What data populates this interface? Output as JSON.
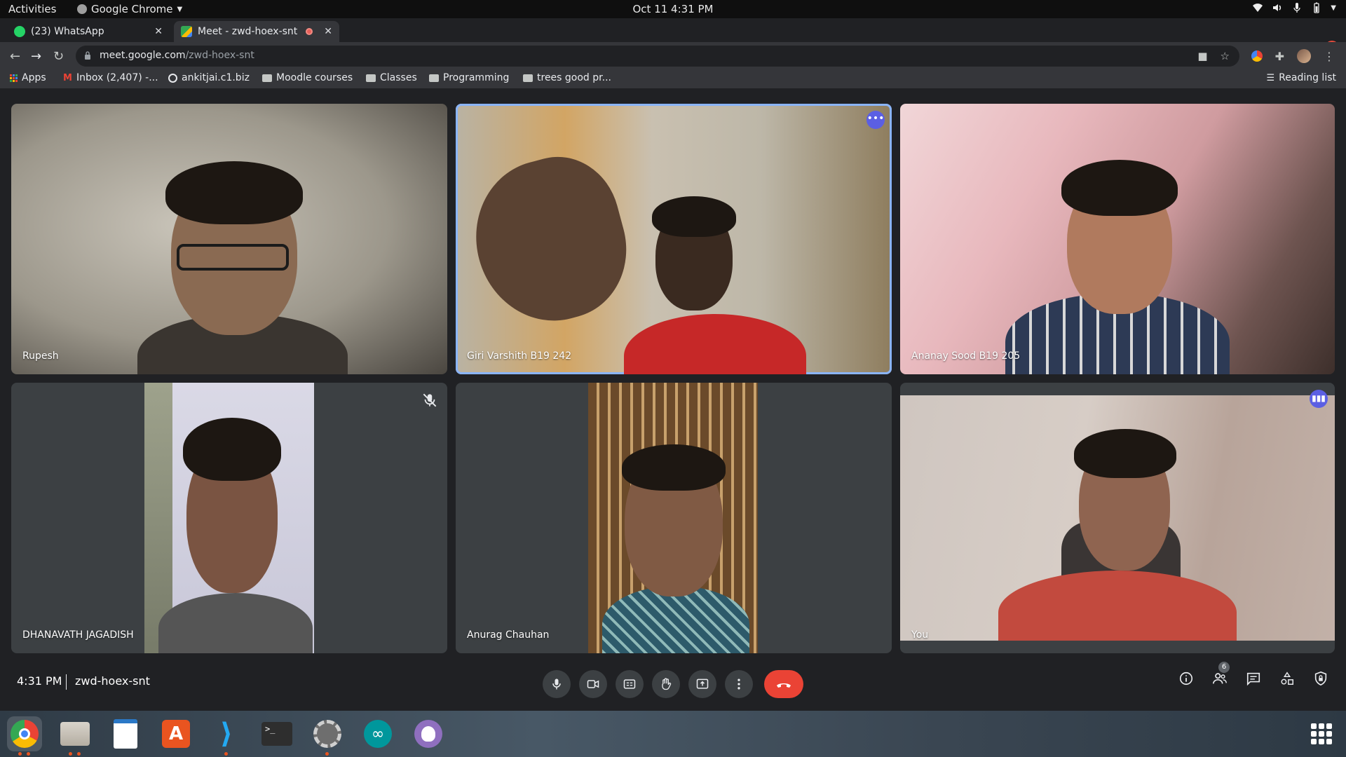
{
  "system_bar": {
    "activities": "Activities",
    "app_name": "Google Chrome",
    "datetime": "Oct 11  4:31 PM"
  },
  "browser": {
    "tabs": [
      {
        "title": "(23) WhatsApp",
        "icon": "whatsapp-icon",
        "active": false
      },
      {
        "title": "Meet - zwd-hoex-snt",
        "icon": "meet-icon",
        "active": true,
        "recording": true
      }
    ],
    "url_domain": "meet.google.com",
    "url_path": "/zwd-hoex-snt",
    "bookmarks": [
      {
        "label": "Apps",
        "icon": "apps-grid-icon"
      },
      {
        "label": "Inbox (2,407) -...",
        "icon": "gmail-icon"
      },
      {
        "label": "ankitjai.c1.biz",
        "icon": "globe-icon"
      },
      {
        "label": "Moodle courses",
        "icon": "folder-icon"
      },
      {
        "label": "Classes",
        "icon": "folder-icon"
      },
      {
        "label": "Programming",
        "icon": "folder-icon"
      },
      {
        "label": "trees good pr...",
        "icon": "folder-icon"
      }
    ],
    "reading_list": "Reading list"
  },
  "meet": {
    "participants": [
      {
        "name": "Rupesh"
      },
      {
        "name": "Giri Varshith B19 242",
        "speaking": true
      },
      {
        "name": "Ananay Sood B19 205"
      },
      {
        "name": "DHANAVATH JAGADISH",
        "muted": true
      },
      {
        "name": "Anurag Chauhan"
      },
      {
        "name": "You"
      }
    ],
    "time": "4:31 PM",
    "meeting_code": "zwd-hoex-snt",
    "people_count": "6"
  },
  "colors": {
    "meet_background": "#202124",
    "tile_background": "#3c4043",
    "end_call": "#ea4335",
    "speaking_outline": "#8ab4f8",
    "badge": "#5b5fe3"
  }
}
